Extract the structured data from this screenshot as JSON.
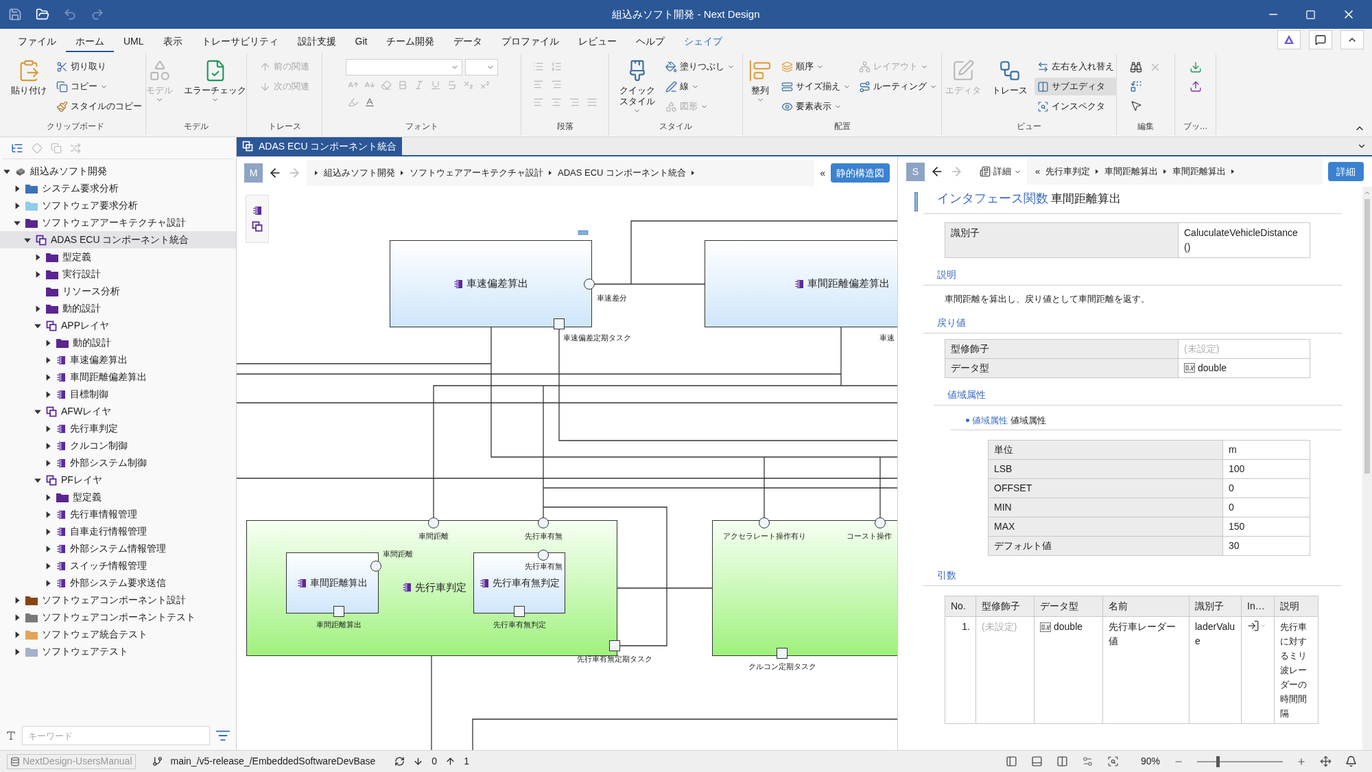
{
  "window": {
    "title": "組込みソフト開発 - Next Design"
  },
  "menu": [
    {
      "label": "ファイル",
      "selected": false,
      "contextual": false
    },
    {
      "label": "ホーム",
      "selected": true,
      "contextual": false
    },
    {
      "label": "UML",
      "selected": false,
      "contextual": false
    },
    {
      "label": "表示",
      "selected": false,
      "contextual": false
    },
    {
      "label": "トレーサビリティ",
      "selected": false,
      "contextual": false
    },
    {
      "label": "設計支援",
      "selected": false,
      "contextual": false
    },
    {
      "label": "Git",
      "selected": false,
      "contextual": false
    },
    {
      "label": "チーム開発",
      "selected": false,
      "contextual": false
    },
    {
      "label": "データ",
      "selected": false,
      "contextual": false
    },
    {
      "label": "プロファイル",
      "selected": false,
      "contextual": false
    },
    {
      "label": "レビュー",
      "selected": false,
      "contextual": false
    },
    {
      "label": "ヘルプ",
      "selected": false,
      "contextual": false
    },
    {
      "label": "シェイプ",
      "selected": false,
      "contextual": true
    }
  ],
  "ribbon": {
    "groups": [
      {
        "label": "クリップボード",
        "items": [
          {
            "label": "貼り付け",
            "kind": "large",
            "disabled": false,
            "dropdown": false,
            "on": false
          },
          {
            "label": "切り取り",
            "kind": "small",
            "disabled": false,
            "dropdown": false,
            "on": false
          },
          {
            "label": "コピー",
            "kind": "small",
            "disabled": false,
            "dropdown": true,
            "on": false
          },
          {
            "label": "スタイルのコピー",
            "kind": "small",
            "disabled": false,
            "dropdown": false,
            "on": false
          }
        ]
      },
      {
        "label": "モデル",
        "items": [
          {
            "label": "モデル",
            "kind": "large",
            "disabled": true,
            "dropdown": true,
            "on": false
          },
          {
            "label": "エラーチェック",
            "kind": "large",
            "disabled": false,
            "dropdown": true,
            "on": false
          }
        ]
      },
      {
        "label": "トレース",
        "items": [
          {
            "label": "前の関連",
            "kind": "small",
            "disabled": true,
            "dropdown": false,
            "on": false
          },
          {
            "label": "次の関連",
            "kind": "small",
            "disabled": true,
            "dropdown": false,
            "on": false
          }
        ]
      },
      {
        "label": "フォント"
      },
      {
        "label": "段落"
      },
      {
        "label": "スタイル",
        "items": [
          {
            "label": "クイックスタイル",
            "kind": "large",
            "disabled": false,
            "dropdown": true,
            "on": false
          },
          {
            "label": "塗りつぶし",
            "kind": "small",
            "disabled": false,
            "dropdown": true,
            "on": false
          },
          {
            "label": "線",
            "kind": "small",
            "disabled": false,
            "dropdown": true,
            "on": false
          },
          {
            "label": "図形",
            "kind": "small",
            "disabled": true,
            "dropdown": true,
            "on": false
          }
        ]
      },
      {
        "label": "配置",
        "items": [
          {
            "label": "整列",
            "kind": "large",
            "disabled": false,
            "dropdown": true,
            "on": false
          },
          {
            "label": "順序",
            "kind": "small",
            "disabled": false,
            "dropdown": true,
            "on": false
          },
          {
            "label": "サイズ揃え",
            "kind": "small",
            "disabled": false,
            "dropdown": true,
            "on": false
          },
          {
            "label": "要素表示",
            "kind": "small",
            "disabled": false,
            "dropdown": true,
            "on": false
          },
          {
            "label": "レイアウト",
            "kind": "small",
            "disabled": true,
            "dropdown": true,
            "on": false
          },
          {
            "label": "ルーティング",
            "kind": "small",
            "disabled": false,
            "dropdown": true,
            "on": false
          }
        ]
      },
      {
        "label": "ビュー",
        "items": [
          {
            "label": "エディタ",
            "kind": "large",
            "disabled": true,
            "dropdown": false,
            "on": false
          },
          {
            "label": "トレース",
            "kind": "large",
            "disabled": false,
            "dropdown": false,
            "on": false
          },
          {
            "label": "左右を入れ替え",
            "kind": "small",
            "disabled": false,
            "dropdown": false,
            "on": false
          },
          {
            "label": "サブエディタ",
            "kind": "small",
            "disabled": false,
            "dropdown": false,
            "on": true
          },
          {
            "label": "インスペクタ",
            "kind": "small",
            "disabled": false,
            "dropdown": false,
            "on": false
          }
        ]
      },
      {
        "label": "編集"
      },
      {
        "label": "ブッ…"
      }
    ]
  },
  "tree": {
    "items": [
      {
        "label": "組込みソフト開発",
        "kind": "root",
        "expanded": true,
        "selected": false,
        "children": [
          {
            "label": "システム要求分析",
            "kind": "folder",
            "color": "#3b72b5",
            "expanded": false,
            "selected": false
          },
          {
            "label": "ソフトウェア要求分析",
            "kind": "folder",
            "color": "#8ccdec",
            "expanded": false,
            "selected": false
          },
          {
            "label": "ソフトウェアアーキテクチャ設計",
            "kind": "folder",
            "color": "#5a2590",
            "expanded": true,
            "selected": false,
            "children": [
              {
                "label": "ADAS ECU コンポーネント統合",
                "kind": "package",
                "expanded": true,
                "selected": true,
                "children": [
                  {
                    "label": "型定義",
                    "kind": "folder",
                    "color": "#5a2590",
                    "expanded": false,
                    "selected": false
                  },
                  {
                    "label": "実行設計",
                    "kind": "folder",
                    "color": "#5a2590",
                    "expanded": false,
                    "selected": false
                  },
                  {
                    "label": "リソース分析",
                    "kind": "folder",
                    "color": "#5a2590",
                    "selected": false
                  },
                  {
                    "label": "動的設計",
                    "kind": "folder",
                    "color": "#5a2590",
                    "expanded": false,
                    "selected": false
                  },
                  {
                    "label": "APPレイヤ",
                    "kind": "package",
                    "expanded": true,
                    "selected": false,
                    "children": [
                      {
                        "label": "動的設計",
                        "kind": "folder",
                        "color": "#5a2590",
                        "expanded": false,
                        "selected": false
                      },
                      {
                        "label": "車速偏差算出",
                        "kind": "component",
                        "expanded": false,
                        "selected": false
                      },
                      {
                        "label": "車間距離偏差算出",
                        "kind": "component",
                        "expanded": false,
                        "selected": false
                      },
                      {
                        "label": "目標制御",
                        "kind": "component",
                        "expanded": false,
                        "selected": false
                      }
                    ]
                  },
                  {
                    "label": "AFWレイヤ",
                    "kind": "package",
                    "expanded": true,
                    "selected": false,
                    "children": [
                      {
                        "label": "先行車判定",
                        "kind": "component",
                        "expanded": false,
                        "selected": false
                      },
                      {
                        "label": "クルコン制御",
                        "kind": "component",
                        "expanded": false,
                        "selected": false
                      },
                      {
                        "label": "外部システム制御",
                        "kind": "component",
                        "expanded": false,
                        "selected": false
                      }
                    ]
                  },
                  {
                    "label": "PFレイヤ",
                    "kind": "package",
                    "expanded": true,
                    "selected": false,
                    "children": [
                      {
                        "label": "型定義",
                        "kind": "folder",
                        "color": "#5a2590",
                        "expanded": false,
                        "selected": false
                      },
                      {
                        "label": "先行車情報管理",
                        "kind": "component",
                        "expanded": false,
                        "selected": false
                      },
                      {
                        "label": "自車走行情報管理",
                        "kind": "component",
                        "expanded": false,
                        "selected": false
                      },
                      {
                        "label": "外部システム情報管理",
                        "kind": "component",
                        "expanded": false,
                        "selected": false
                      },
                      {
                        "label": "スイッチ情報管理",
                        "kind": "component",
                        "expanded": false,
                        "selected": false
                      },
                      {
                        "label": "外部システム要求送信",
                        "kind": "component",
                        "expanded": false,
                        "selected": false
                      }
                    ]
                  }
                ]
              }
            ]
          },
          {
            "label": "ソフトウェアコンポーネント設計",
            "kind": "folder",
            "color": "#8a4413",
            "expanded": false,
            "selected": false
          },
          {
            "label": "ソフトウェアコンポーネントテスト",
            "kind": "folder",
            "color": "#7a7a7a",
            "expanded": false,
            "selected": false
          },
          {
            "label": "ソフトウェア統合テスト",
            "kind": "folder",
            "color": "#e2a458",
            "expanded": false,
            "selected": false
          },
          {
            "label": "ソフトウェアテスト",
            "kind": "folder",
            "color": "#a3b1cc",
            "expanded": false,
            "selected": false
          }
        ]
      }
    ]
  },
  "tree_search": {
    "placeholder": "キーワード"
  },
  "document_tabs": [
    {
      "title": "ADAS ECU コンポーネント統合",
      "selected": true
    }
  ],
  "editor": {
    "badge": "M",
    "breadcrumb": [
      "組込みソフト開発",
      "ソフトウェアアーキテクチャ設計",
      "ADAS ECU コンポーネント統合"
    ],
    "collapse_glyph": "«",
    "view_button": "静的構造図",
    "diagram": {
      "blocks": [
        {
          "kind": "component",
          "name": "車速偏差算出",
          "ports": [
            {
              "kind": "interface",
              "label": "車速差分"
            },
            {
              "kind": "task",
              "label": "車速偏差定期タスク"
            }
          ]
        },
        {
          "kind": "component",
          "name": "車間距離偏差算出",
          "ports": [
            {
              "kind": "offscreen",
              "label": "車速"
            }
          ]
        },
        {
          "kind": "composite",
          "name": "先行車判定",
          "ports": [
            {
              "kind": "interface",
              "label": "車間距離"
            },
            {
              "kind": "interface",
              "label": "先行車有無"
            },
            {
              "kind": "task",
              "label": "先行車有無定期タスク"
            }
          ],
          "parts": [
            {
              "kind": "component",
              "name": "車間距離算出",
              "ports": [
                {
                  "kind": "interface",
                  "label": "車間距離"
                },
                {
                  "kind": "task",
                  "label": "車間距離算出"
                }
              ]
            },
            {
              "kind": "component",
              "name": "先行車有無判定",
              "ports": [
                {
                  "kind": "interface",
                  "label": "先行車有無"
                },
                {
                  "kind": "task",
                  "label": "先行車有無判定"
                }
              ]
            }
          ]
        },
        {
          "kind": "composite",
          "ports": [
            {
              "kind": "interface",
              "label": "アクセラレート操作有り"
            },
            {
              "kind": "interface",
              "label": "コースト操作"
            },
            {
              "kind": "task",
              "label": "クルコン定期タスク"
            }
          ]
        }
      ]
    }
  },
  "inspector": {
    "badge": "S",
    "view_menu": "詳細",
    "collapse_glyph": "«",
    "breadcrumb": [
      "先行車判定",
      "車間距離算出",
      "車間距離算出"
    ],
    "mode_button": "詳細",
    "heading": {
      "type": "インタフェース関数",
      "name": "車間距離算出"
    },
    "identifier": {
      "label": "識別子",
      "value": "CaluculateVehicleDistance()"
    },
    "description": {
      "title": "説明",
      "text": "車間距離を算出し、戻り値として車間距離を返す。"
    },
    "return_value": {
      "title": "戻り値",
      "rows": [
        {
          "label": "型修飾子",
          "kind": "text",
          "value": "(未設定)",
          "unset": true
        },
        {
          "label": "データ型",
          "kind": "type",
          "value": "double",
          "unset": false
        }
      ]
    },
    "range": {
      "title": "値域属性",
      "item_type": "値域属性",
      "item_name": "値域属性",
      "rows": [
        {
          "label": "単位",
          "value": "m"
        },
        {
          "label": "LSB",
          "value": "100"
        },
        {
          "label": "OFFSET",
          "value": "0"
        },
        {
          "label": "MIN",
          "value": "0"
        },
        {
          "label": "MAX",
          "value": "150"
        },
        {
          "label": "デフォルト値",
          "value": "30"
        }
      ]
    },
    "arguments": {
      "title": "引数",
      "columns": [
        "No.",
        "型修飾子",
        "データ型",
        "名前",
        "識別子",
        "In…",
        "説明"
      ],
      "rows": [
        {
          "no": "1.",
          "modifier": "(未設定)",
          "modifier_unset": true,
          "type": "double",
          "name": "先行車レーダー値",
          "identifier": "laderValue",
          "description": "先行車に対するミリ波レーダーの時間間隔"
        }
      ]
    }
  },
  "status_bar": {
    "repository": "NextDesign-UsersManual",
    "branch": "main_/v5-release_/EmbeddedSoftwareDevBase",
    "incoming": "0",
    "outgoing": "1",
    "zoom": "90%",
    "zoom_slider": {
      "level": 0.24
    }
  }
}
